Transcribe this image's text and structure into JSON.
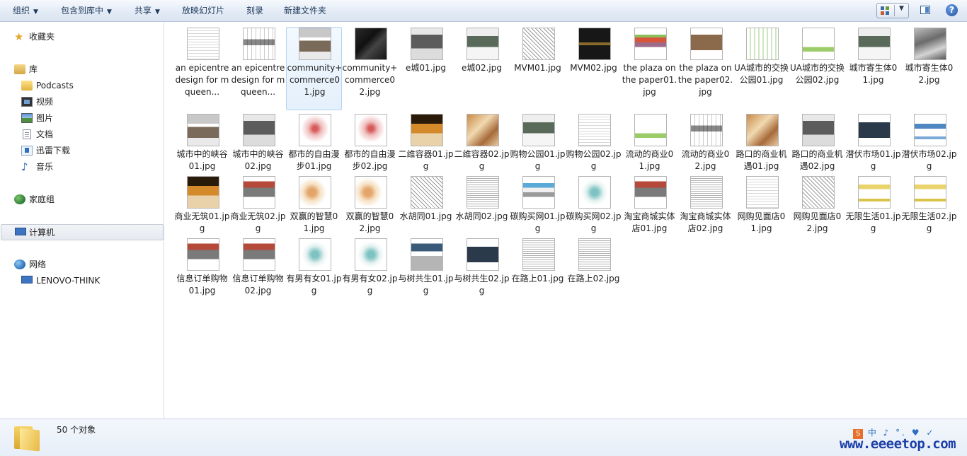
{
  "toolbar": {
    "organize": "组织",
    "include_library": "包含到库中",
    "share": "共享",
    "slideshow": "放映幻灯片",
    "burn": "刻录",
    "new_folder": "新建文件夹"
  },
  "sidebar": {
    "favorites": "收藏夹",
    "libraries": "库",
    "podcasts": "Podcasts",
    "videos": "视频",
    "pictures": "图片",
    "documents": "文档",
    "thunder": "迅雷下载",
    "music": "音乐",
    "homegroup": "家庭组",
    "computer": "计算机",
    "network": "网络",
    "lenovo": "LENOVO-THINK"
  },
  "files": [
    {
      "name": "an epicentre design for mqueen...",
      "thumb": "white",
      "selected": false
    },
    {
      "name": "an epicentre design for mqueen...",
      "thumb": "white2",
      "selected": false
    },
    {
      "name": "community+commerce01.jpg",
      "thumb": "mixed",
      "selected": true
    },
    {
      "name": "community+commerce02.jpg",
      "thumb": "dark",
      "selected": false
    },
    {
      "name": "e城01.jpg",
      "thumb": "grayphoto",
      "selected": false
    },
    {
      "name": "e城02.jpg",
      "thumb": "sky",
      "selected": false
    },
    {
      "name": "MVM01.jpg",
      "thumb": "lines",
      "selected": false
    },
    {
      "name": "MVM02.jpg",
      "thumb": "darkpanel",
      "selected": false
    },
    {
      "name": "the plaza on the paper01.jpg",
      "thumb": "plaza",
      "selected": false
    },
    {
      "name": "the plaza on the paper02.jpg",
      "thumb": "plaza2",
      "selected": false
    },
    {
      "name": "UA城市的交换公园01.jpg",
      "thumb": "green",
      "selected": false
    },
    {
      "name": "UA城市的交换公园02.jpg",
      "thumb": "greenband",
      "selected": false
    },
    {
      "name": "城市寄生体01.jpg",
      "thumb": "sky",
      "selected": false
    },
    {
      "name": "城市寄生体02.jpg",
      "thumb": "gray",
      "selected": false
    },
    {
      "name": "城市中的峡谷01.jpg",
      "thumb": "mixed",
      "selected": false
    },
    {
      "name": "城市中的峡谷02.jpg",
      "thumb": "grayphoto",
      "selected": false
    },
    {
      "name": "都市的自由漫步01.jpg",
      "thumb": "red",
      "selected": false
    },
    {
      "name": "都市的自由漫步02.jpg",
      "thumb": "red",
      "selected": false
    },
    {
      "name": "二维容器01.jpg",
      "thumb": "orange",
      "selected": false
    },
    {
      "name": "二维容器02.jpg",
      "thumb": "brown",
      "selected": false
    },
    {
      "name": "购物公园01.jpg",
      "thumb": "sky",
      "selected": false
    },
    {
      "name": "购物公园02.jpg",
      "thumb": "white",
      "selected": false
    },
    {
      "name": "流动的商业01.jpg",
      "thumb": "greenband",
      "selected": false
    },
    {
      "name": "流动的商业02.jpg",
      "thumb": "white2",
      "selected": false
    },
    {
      "name": "路口的商业机遇01.jpg",
      "thumb": "brown",
      "selected": false
    },
    {
      "name": "路口的商业机遇02.jpg",
      "thumb": "grayphoto",
      "selected": false
    },
    {
      "name": "潜伏市场01.jpg",
      "thumb": "night",
      "selected": false
    },
    {
      "name": "潜伏市场02.jpg",
      "thumb": "blue",
      "selected": false
    },
    {
      "name": "商业无筑01.jpg",
      "thumb": "orange",
      "selected": false
    },
    {
      "name": "商业无筑02.jpg",
      "thumb": "ruined",
      "selected": false
    },
    {
      "name": "双赢的智慧01.jpg",
      "thumb": "map",
      "selected": false
    },
    {
      "name": "双赢的智慧02.jpg",
      "thumb": "map",
      "selected": false
    },
    {
      "name": "水胡同01.jpg",
      "thumb": "lines",
      "selected": false
    },
    {
      "name": "水胡同02.jpg",
      "thumb": "dense",
      "selected": false
    },
    {
      "name": "碳购买网01.jpg",
      "thumb": "colorful",
      "selected": false
    },
    {
      "name": "碳购买网02.jpg",
      "thumb": "teal",
      "selected": false
    },
    {
      "name": "淘宝商城实体店01.jpg",
      "thumb": "ruined",
      "selected": false
    },
    {
      "name": "淘宝商城实体店02.jpg",
      "thumb": "dense",
      "selected": false
    },
    {
      "name": "网购见面店01.jpg",
      "thumb": "white",
      "selected": false
    },
    {
      "name": "网购见面店02.jpg",
      "thumb": "lines",
      "selected": false
    },
    {
      "name": "无限生活01.jpg",
      "thumb": "yellow",
      "selected": false
    },
    {
      "name": "无限生活02.jpg",
      "thumb": "yellow",
      "selected": false
    },
    {
      "name": "信息订单购物01.jpg",
      "thumb": "ruined",
      "selected": false
    },
    {
      "name": "信息订单购物02.jpg",
      "thumb": "ruined",
      "selected": false
    },
    {
      "name": "有男有女01.jpg",
      "thumb": "teal",
      "selected": false
    },
    {
      "name": "有男有女02.jpg",
      "thumb": "teal",
      "selected": false
    },
    {
      "name": "与树共生01.jpg",
      "thumb": "photo2",
      "selected": false
    },
    {
      "name": "与树共生02.jpg",
      "thumb": "night",
      "selected": false
    },
    {
      "name": "在路上01.jpg",
      "thumb": "dense",
      "selected": false
    },
    {
      "name": "在路上02.jpg",
      "thumb": "dense",
      "selected": false
    }
  ],
  "status": {
    "count": "50 个对象"
  },
  "watermark": {
    "icons": "中 ♪ °. ♥ ✓",
    "site": "www.eeeetop.com"
  }
}
